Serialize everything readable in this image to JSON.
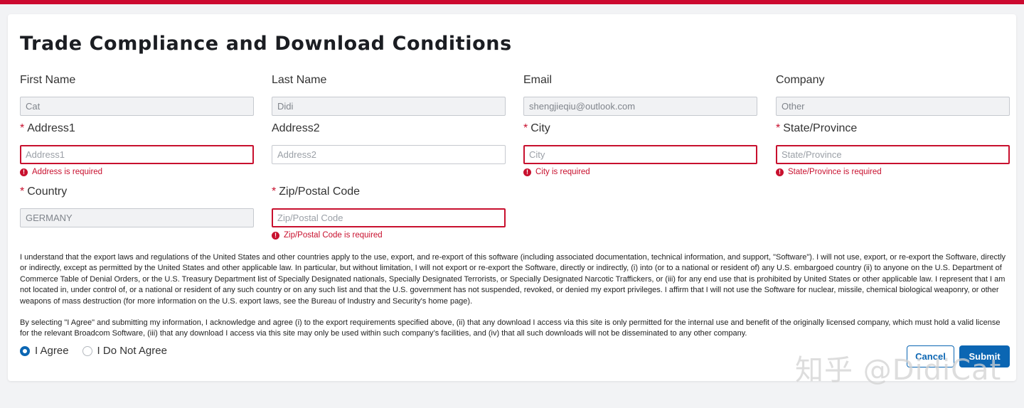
{
  "colors": {
    "top_bar": "#cc092f",
    "accent": "#0b66b3",
    "error": "#c8102e"
  },
  "title": "Trade Compliance and Download Conditions",
  "fields": {
    "first_name": {
      "label": "First Name",
      "value": "Cat",
      "required": false
    },
    "last_name": {
      "label": "Last Name",
      "value": "Didi",
      "required": false
    },
    "email": {
      "label": "Email",
      "value": "shengjieqiu@outlook.com",
      "required": false
    },
    "company": {
      "label": "Company",
      "value": "Other",
      "required": false
    },
    "address1": {
      "label": "Address1",
      "placeholder": "Address1",
      "required_mark": "*",
      "error": "Address is required"
    },
    "address2": {
      "label": "Address2",
      "placeholder": "Address2"
    },
    "city": {
      "label": "City",
      "placeholder": "City",
      "required_mark": "*",
      "error": "City is required"
    },
    "state": {
      "label": "State/Province",
      "placeholder": "State/Province",
      "required_mark": "*",
      "error": "State/Province is required"
    },
    "country": {
      "label": "Country",
      "value": "GERMANY",
      "required_mark": "*"
    },
    "zip": {
      "label": "Zip/Postal Code",
      "placeholder": "Zip/Postal Code",
      "required_mark": "*",
      "error": "Zip/Postal Code is required"
    }
  },
  "error_icon": "exclamation-circle-icon",
  "legal": {
    "paragraph1": "I understand that the export laws and regulations of the United States and other countries apply to the use, export, and re-export of this software (including associated documentation, technical information, and support, \"Software\"). I will not use, export, or re-export the Software, directly or indirectly, except as permitted by the United States and other applicable law. In particular, but without limitation, I will not export or re-export the Software, directly or indirectly, (i) into (or to a national or resident of) any U.S. embargoed country (ii) to anyone on the U.S. Department of Commerce Table of Denial Orders, or the U.S. Treasury Department list of Specially Designated nationals, Specially Designated Terrorists, or Specially Designated Narcotic Traffickers, or (iii) for any end use that is prohibited by United States or other applicable law. I represent that I am not located in, under control of, or a national or resident of any such country or on any such list and that the U.S. government has not suspended, revoked, or denied my export privileges. I affirm that I will not use the Software for nuclear, missile, chemical biological weaponry, or other weapons of mass destruction (for more information on the U.S. export laws, see the Bureau of Industry and Security's home page).",
    "paragraph2": "By selecting \"I Agree\" and submitting my information, I acknowledge and agree (i) to the export requirements specified above, (ii) that any download I access via this site is only permitted for the internal use and benefit of the originally licensed company, which must hold a valid license for the relevant Broadcom Software, (iii) that any download I access via this site may only be used within such company’s facilities, and (iv) that all such downloads will not be disseminated to any other company."
  },
  "agreement": {
    "agree_label": "I Agree",
    "disagree_label": "I Do Not Agree",
    "selected": "agree"
  },
  "buttons": {
    "cancel": "Cancel",
    "submit": "Submit"
  },
  "watermark": "知乎 @DidiCat"
}
